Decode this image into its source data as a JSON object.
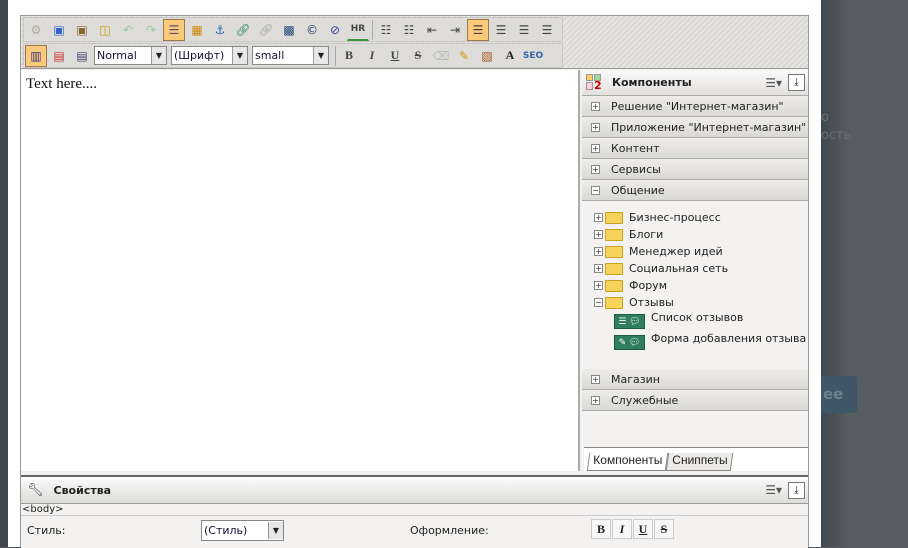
{
  "toolbar": {
    "style_select": "Normal",
    "font_select": "(Шрифт)",
    "size_select": "small",
    "row1_icons": [
      "settings-icon",
      "paste-word-icon",
      "paste-text-icon",
      "select-all-icon",
      "undo-icon",
      "redo-icon",
      "toggle-borders-icon",
      "table-icon",
      "anchor-icon",
      "link-icon",
      "unlink-icon",
      "image-icon",
      "special-char-icon",
      "flash-icon",
      "horizontal-rule-icon",
      "ordered-list-icon",
      "unordered-list-icon",
      "outdent-icon",
      "indent-icon",
      "align-left-icon",
      "align-center-icon",
      "align-right-icon",
      "justify-icon"
    ],
    "hr_label": "HR",
    "seo_label": "SEO"
  },
  "editor": {
    "content": "Text here...."
  },
  "components": {
    "title": "Компоненты",
    "groups_top": [
      {
        "label": "Решение \"Интернет-магазин\""
      },
      {
        "label": "Приложение \"Интернет-магазин\""
      },
      {
        "label": "Контент"
      },
      {
        "label": "Сервисы"
      }
    ],
    "open_group": "Общение",
    "tree": [
      {
        "label": "Бизнес-процесс"
      },
      {
        "label": "Блоги"
      },
      {
        "label": "Менеджер идей"
      },
      {
        "label": "Социальная сеть"
      },
      {
        "label": "Форум"
      },
      {
        "label": "Отзывы"
      }
    ],
    "leaves": [
      {
        "label": "Список отзывов"
      },
      {
        "label": "Форма добавления отзыва"
      }
    ],
    "groups_bottom": [
      {
        "label": "Магазин"
      },
      {
        "label": "Служебные"
      }
    ],
    "tabs": [
      "Компоненты",
      "Сниппеты"
    ]
  },
  "props": {
    "title": "Свойства",
    "path": "<body>",
    "style_label": "Стиль:",
    "style_value": "(Стиль)",
    "decor_label": "Оформление:",
    "bold": "B",
    "italic": "I",
    "underline": "U",
    "strike": "S"
  },
  "background": {
    "t1": "о",
    "t2": "ость",
    "btn": "ее"
  }
}
